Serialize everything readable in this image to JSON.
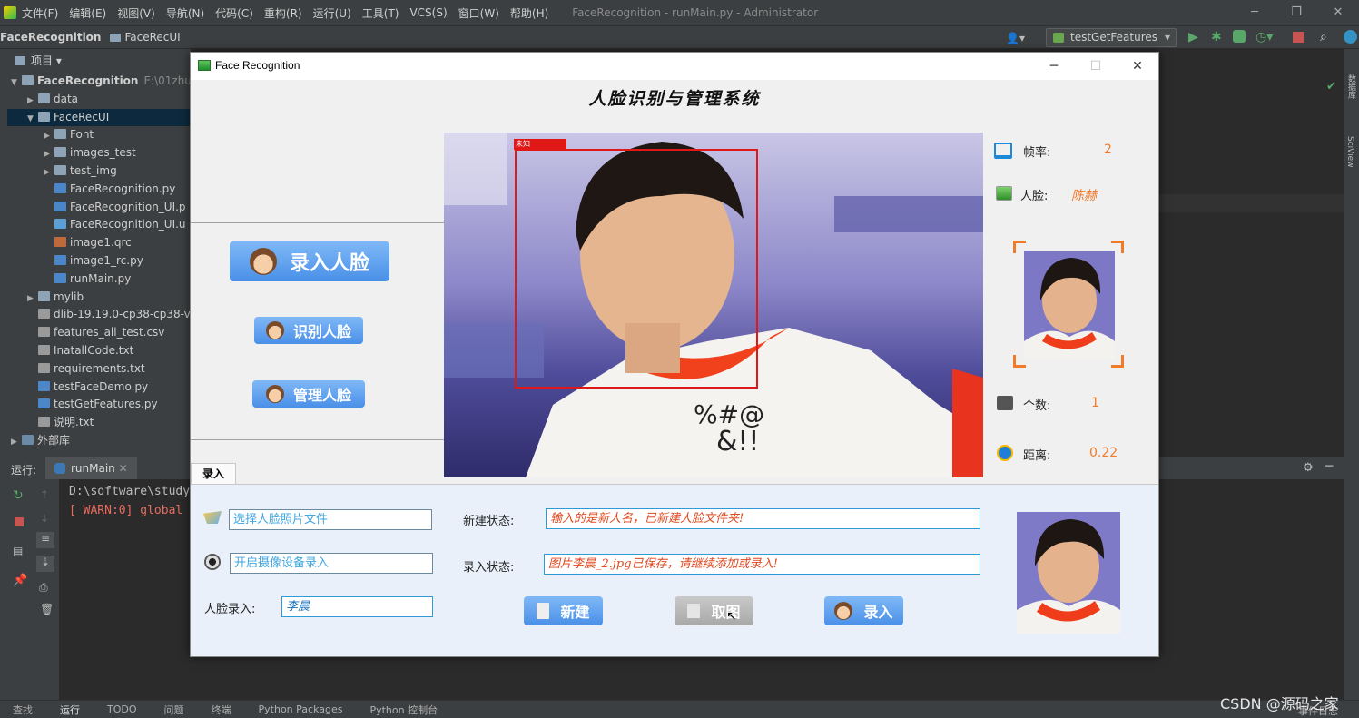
{
  "ide": {
    "menu": [
      "文件(F)",
      "编辑(E)",
      "视图(V)",
      "导航(N)",
      "代码(C)",
      "重构(R)",
      "运行(U)",
      "工具(T)",
      "VCS(S)",
      "窗口(W)",
      "帮助(H)"
    ],
    "window_title": "FaceRecognition - runMain.py - Administrator",
    "breadcrumb": [
      "FaceRecognition",
      "FaceRecUI"
    ],
    "run_config": "testGetFeatures",
    "project_header": "项目",
    "tree": [
      {
        "label": "FaceRecognition",
        "extra": "E:\\01zhuo",
        "indent": 0,
        "arrow": "▼",
        "icon": "folder",
        "bold": true
      },
      {
        "label": "data",
        "indent": 1,
        "arrow": "▶",
        "icon": "folder"
      },
      {
        "label": "FaceRecUI",
        "indent": 1,
        "arrow": "▼",
        "icon": "folder",
        "selected": true
      },
      {
        "label": "Font",
        "indent": 2,
        "arrow": "▶",
        "icon": "folder"
      },
      {
        "label": "images_test",
        "indent": 2,
        "arrow": "▶",
        "icon": "folder"
      },
      {
        "label": "test_img",
        "indent": 2,
        "arrow": "▶",
        "icon": "folder"
      },
      {
        "label": "FaceRecognition.py",
        "indent": 2,
        "icon": "py"
      },
      {
        "label": "FaceRecognition_UI.p",
        "indent": 2,
        "icon": "py"
      },
      {
        "label": "FaceRecognition_UI.u",
        "indent": 2,
        "icon": "ui"
      },
      {
        "label": "image1.qrc",
        "indent": 2,
        "icon": "qrc"
      },
      {
        "label": "image1_rc.py",
        "indent": 2,
        "icon": "py"
      },
      {
        "label": "runMain.py",
        "indent": 2,
        "icon": "py"
      },
      {
        "label": "mylib",
        "indent": 1,
        "arrow": "▶",
        "icon": "folder"
      },
      {
        "label": "dlib-19.19.0-cp38-cp38-v",
        "indent": 1,
        "icon": "file"
      },
      {
        "label": "features_all_test.csv",
        "indent": 1,
        "icon": "file"
      },
      {
        "label": "InatallCode.txt",
        "indent": 1,
        "icon": "file"
      },
      {
        "label": "requirements.txt",
        "indent": 1,
        "icon": "file"
      },
      {
        "label": "testFaceDemo.py",
        "indent": 1,
        "icon": "py"
      },
      {
        "label": "testGetFeatures.py",
        "indent": 1,
        "icon": "py"
      },
      {
        "label": "说明.txt",
        "indent": 1,
        "icon": "file"
      },
      {
        "label": "外部库",
        "indent": 0,
        "arrow": "▶",
        "icon": "lib"
      }
    ],
    "run_label": "运行:",
    "run_tab": "runMain",
    "console": [
      "D:\\software\\study",
      "[ WARN:0] global"
    ],
    "status_tabs": [
      "查找",
      "运行",
      "TODO",
      "问题",
      "终端",
      "Python Packages",
      "Python 控制台"
    ],
    "event_log": "事件日志",
    "watermark": "CSDN @源码之家",
    "right_strip": [
      "数据库",
      "SciView"
    ]
  },
  "app": {
    "title": "Face Recognition",
    "system_name": "人脸识别与管理系统",
    "buttons": {
      "enroll_face": "录入人脸",
      "recognize_face": "识别人脸",
      "manage_face": "管理人脸"
    },
    "face_tag": "未知",
    "info": {
      "fps_label": "帧率:",
      "fps_value": "2",
      "face_label": "人脸:",
      "face_value": "陈赫",
      "count_label": "个数:",
      "count_value": "1",
      "distance_label": "距离:",
      "distance_value": "0.22"
    },
    "tab": "录入",
    "enroll": {
      "select_photo_placeholder": "选择人脸照片文件",
      "camera_placeholder": "开启摄像设备录入",
      "name_label": "人脸录入:",
      "name_value": "李晨",
      "new_status_label": "新建状态:",
      "new_status_value": "输入的是新人名，已新建人脸文件夹!",
      "enroll_status_label": "录入状态:",
      "enroll_status_value": "图片李晨_2.jpg已保存，请继续添加或录入!",
      "btn_new": "新建",
      "btn_capture": "取图",
      "btn_enroll": "录入"
    }
  }
}
